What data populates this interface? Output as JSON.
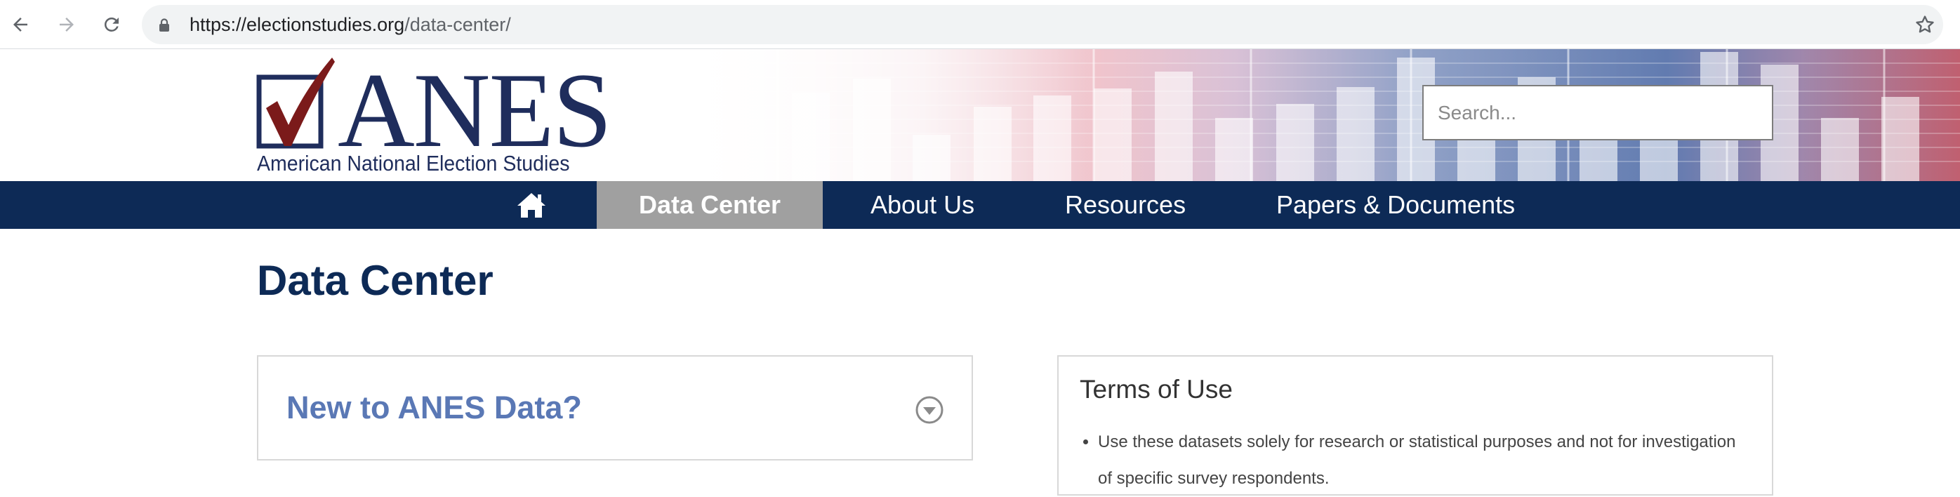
{
  "browser": {
    "url_domain": "https://electionstudies.org",
    "url_path": "/data-center/",
    "icons": [
      "back-arrow-icon",
      "forward-arrow-icon",
      "reload-icon",
      "lock-icon",
      "bookmark-star-icon"
    ]
  },
  "header": {
    "logo_text": "ANES",
    "logo_subtitle": "American National Election Studies",
    "search_placeholder": "Search..."
  },
  "nav": {
    "home_icon": "home-icon",
    "items": [
      {
        "label": "Data Center",
        "active": true
      },
      {
        "label": "About Us",
        "active": false
      },
      {
        "label": "Resources",
        "active": false
      },
      {
        "label": "Papers & Documents",
        "active": false
      }
    ]
  },
  "main": {
    "page_title": "Data Center",
    "accordion": {
      "title": "New to ANES Data?",
      "toggle_icon": "chevron-down-circle-icon"
    },
    "terms": {
      "heading": "Terms of Use",
      "items": [
        "Use these datasets solely for research or statistical purposes and not for investigation of specific survey respondents."
      ]
    }
  },
  "colors": {
    "navy": "#0d2a56",
    "nav_active": "#a0a0a0",
    "accordion_title": "#5a78b5",
    "logo_red": "#7b1a1a",
    "logo_navy": "#1f2d5c"
  }
}
